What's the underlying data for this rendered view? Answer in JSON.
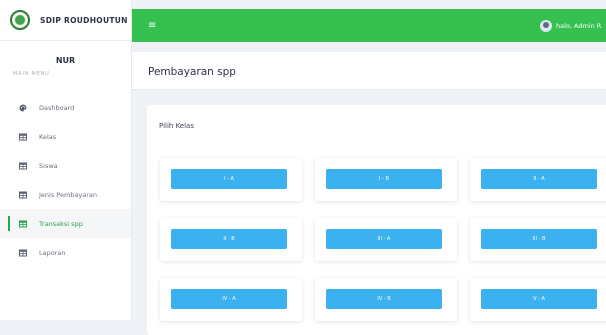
{
  "sidebar": {
    "brand": "SDIP ROUDHOUTUN",
    "user": "NUR",
    "menu_label": "MAIN MENU",
    "items": [
      {
        "label": "Dashboard",
        "icon": "palette-icon"
      },
      {
        "label": "Kelas",
        "icon": "table-icon"
      },
      {
        "label": "Siswa",
        "icon": "table-icon"
      },
      {
        "label": "Jenis Pembayaran",
        "icon": "table-icon"
      },
      {
        "label": "Transaksi spp",
        "icon": "table-icon",
        "active": true
      },
      {
        "label": "Laporan",
        "icon": "table-icon"
      }
    ]
  },
  "topbar": {
    "menu_icon": "≡",
    "greeting": "halo, Admin R"
  },
  "page": {
    "title": "Pembayaran spp"
  },
  "content": {
    "title": "Pilih Kelas",
    "classes": [
      "I - A",
      "I - B",
      "II - A",
      "II - B",
      "III - A",
      "III - B",
      "IV - A",
      "IV - B",
      "V - A"
    ]
  },
  "colors": {
    "primary_green": "#35c050",
    "active_green": "#27a84a",
    "button_blue": "#3cb1ef"
  }
}
